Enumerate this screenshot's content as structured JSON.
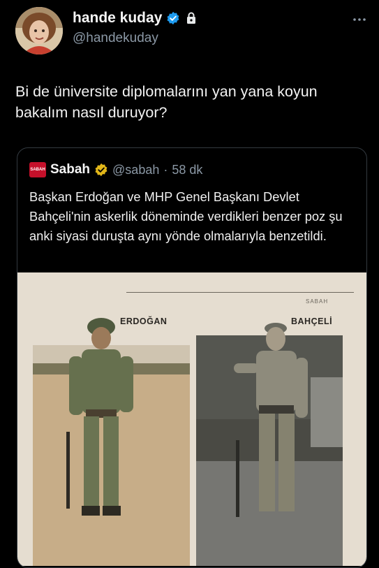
{
  "author": {
    "display_name": "hande kuday",
    "handle": "@handekuday",
    "verified_icon": "verified-badge-icon",
    "protected_icon": "lock-icon",
    "more_icon": "more-options-icon"
  },
  "tweet": {
    "text": "Bi de üniversite diplomalarını yan yana koyun bakalım nasıl duruyor?"
  },
  "quoted": {
    "logo_text": "SABAH",
    "display_name": "Sabah",
    "handle": "@sabah",
    "separator": "·",
    "time": "58 dk",
    "text": "Başkan Erdoğan ve MHP Genel Başkanı Devlet Bahçeli'nin askerlik döneminde verdikleri benzer poz şu anki siyasi duruşta aynı yönde olmalarıyla benzetildi.",
    "image": {
      "brand": "SABAH",
      "label_left": "ERDOĞAN",
      "label_right": "BAHÇELİ"
    }
  },
  "colors": {
    "background": "#000000",
    "verified_blue": "#1d9bf0",
    "gold_badge": "#e2b719",
    "sabah_red": "#c4102a"
  }
}
